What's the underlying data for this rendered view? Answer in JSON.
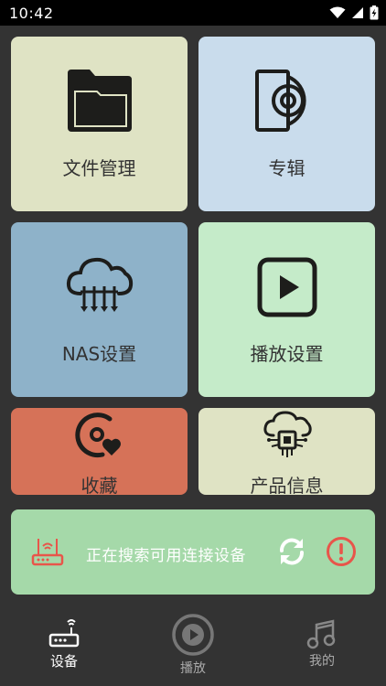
{
  "status_bar": {
    "time": "10:42"
  },
  "tiles": {
    "files": {
      "label": "文件管理",
      "icon": "folder-icon",
      "color": "#dfe3c4"
    },
    "album": {
      "label": "专辑",
      "icon": "album-disc-icon",
      "color": "#c9dcec"
    },
    "nas": {
      "label": "NAS设置",
      "icon": "cloud-network-icon",
      "color": "#8eb2c9"
    },
    "playback": {
      "label": "播放设置",
      "icon": "play-square-icon",
      "color": "#c5ebc9"
    },
    "favorites": {
      "label": "收藏",
      "icon": "disc-heart-icon",
      "color": "#d67258"
    },
    "product_info": {
      "label": "产品信息",
      "icon": "cloud-chip-icon",
      "color": "#dfe3c4"
    }
  },
  "device_search": {
    "text": "正在搜索可用连接设备",
    "router_icon": "router-icon",
    "refresh_icon": "refresh-icon",
    "alert_icon": "alert-circle-icon",
    "color": "#a5d9a9"
  },
  "bottom_nav": {
    "items": [
      {
        "label": "设备",
        "icon": "router-icon",
        "active": true
      },
      {
        "label": "播放",
        "icon": "play-circle-icon",
        "active": false
      },
      {
        "label": "我的",
        "icon": "music-note-icon",
        "active": false
      }
    ]
  }
}
